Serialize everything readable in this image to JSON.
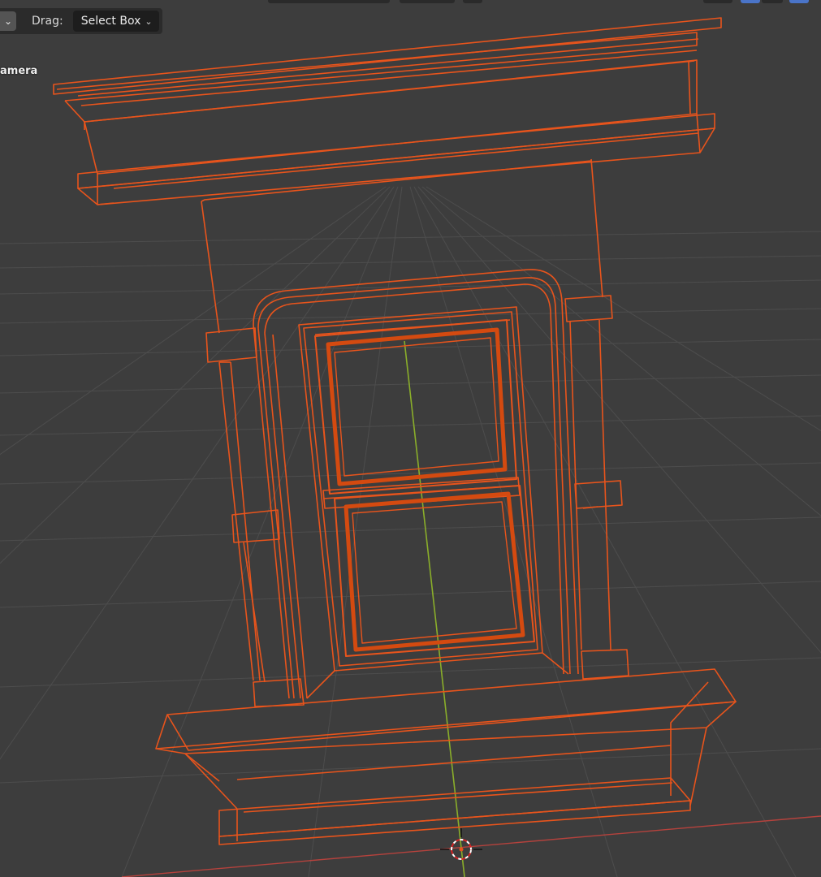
{
  "header": {
    "drag_label": "Drag:",
    "select_mode": "Select Box",
    "mode_menu_icon": "chevron-down-icon"
  },
  "viewport": {
    "view_name": "amera",
    "background_color": "#3d3d3d",
    "wire_color": "#e8541c",
    "grid_color": "#4f4f4f",
    "x_axis_color": "#b5423d",
    "y_axis_color": "#8aae2a",
    "cursor_icon": "3d-cursor-icon"
  }
}
